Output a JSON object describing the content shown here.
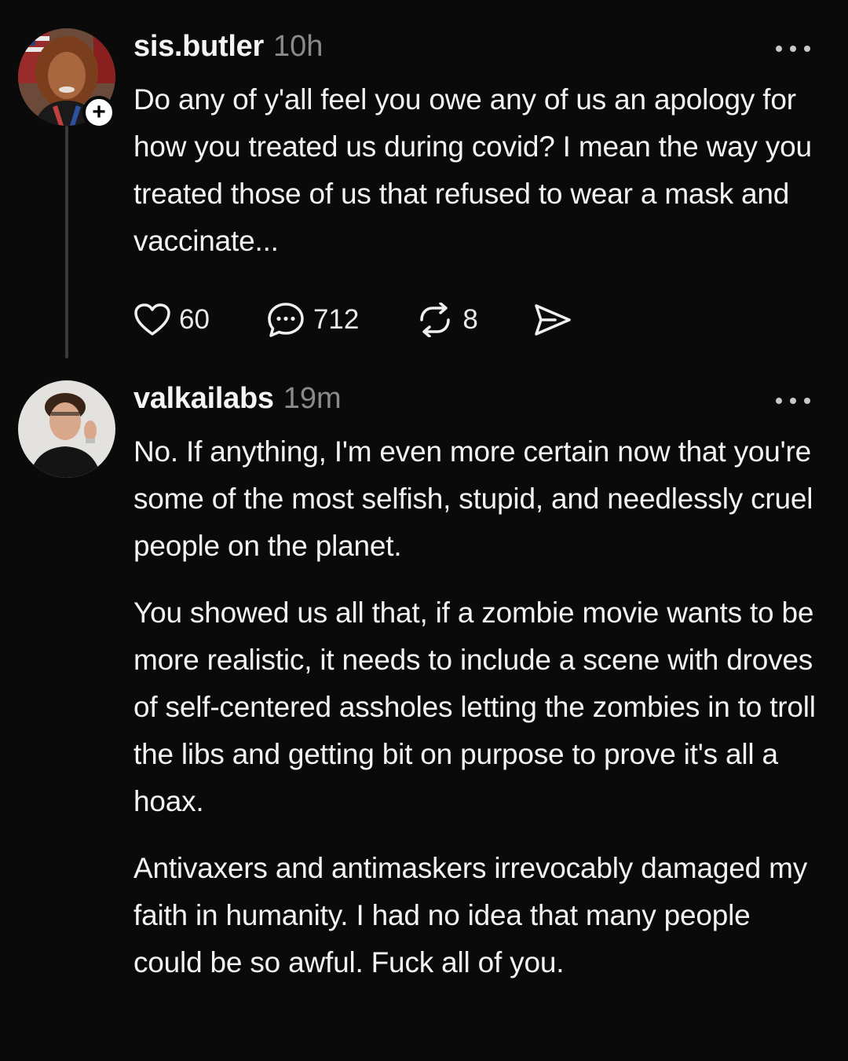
{
  "posts": [
    {
      "username": "sis.butler",
      "timestamp": "10h",
      "avatar_icon": "avatar-photo-woman",
      "follow_icon": "plus-icon",
      "follow_symbol": "+",
      "paragraphs": [
        "Do any of y'all feel you owe any of us an apology for how you treated us during covid?  I mean the way you treated those of us that refused to wear a mask and vaccinate..."
      ],
      "actions": {
        "likes": "60",
        "replies": "712",
        "reposts": "8"
      }
    },
    {
      "username": "valkailabs",
      "timestamp": "19m",
      "avatar_icon": "avatar-photo-man",
      "paragraphs": [
        "No. If anything, I'm even more certain now that you're some of the most selfish, stupid, and needlessly cruel people on the planet.",
        "You showed us all that, if a zombie movie wants to be more realistic, it needs to include a scene with droves of self-centered assholes letting the zombies in to troll the libs and getting bit on purpose to prove it's all a hoax.",
        "Antivaxers and antimaskers irrevocably damaged my faith in humanity. I had no idea that many people could be so awful. Fuck all of you."
      ]
    }
  ],
  "colors": {
    "background": "#0a0a0a",
    "text": "#f3f3f3",
    "muted": "#8a8a8a",
    "thread_line": "#3a3a3a"
  }
}
